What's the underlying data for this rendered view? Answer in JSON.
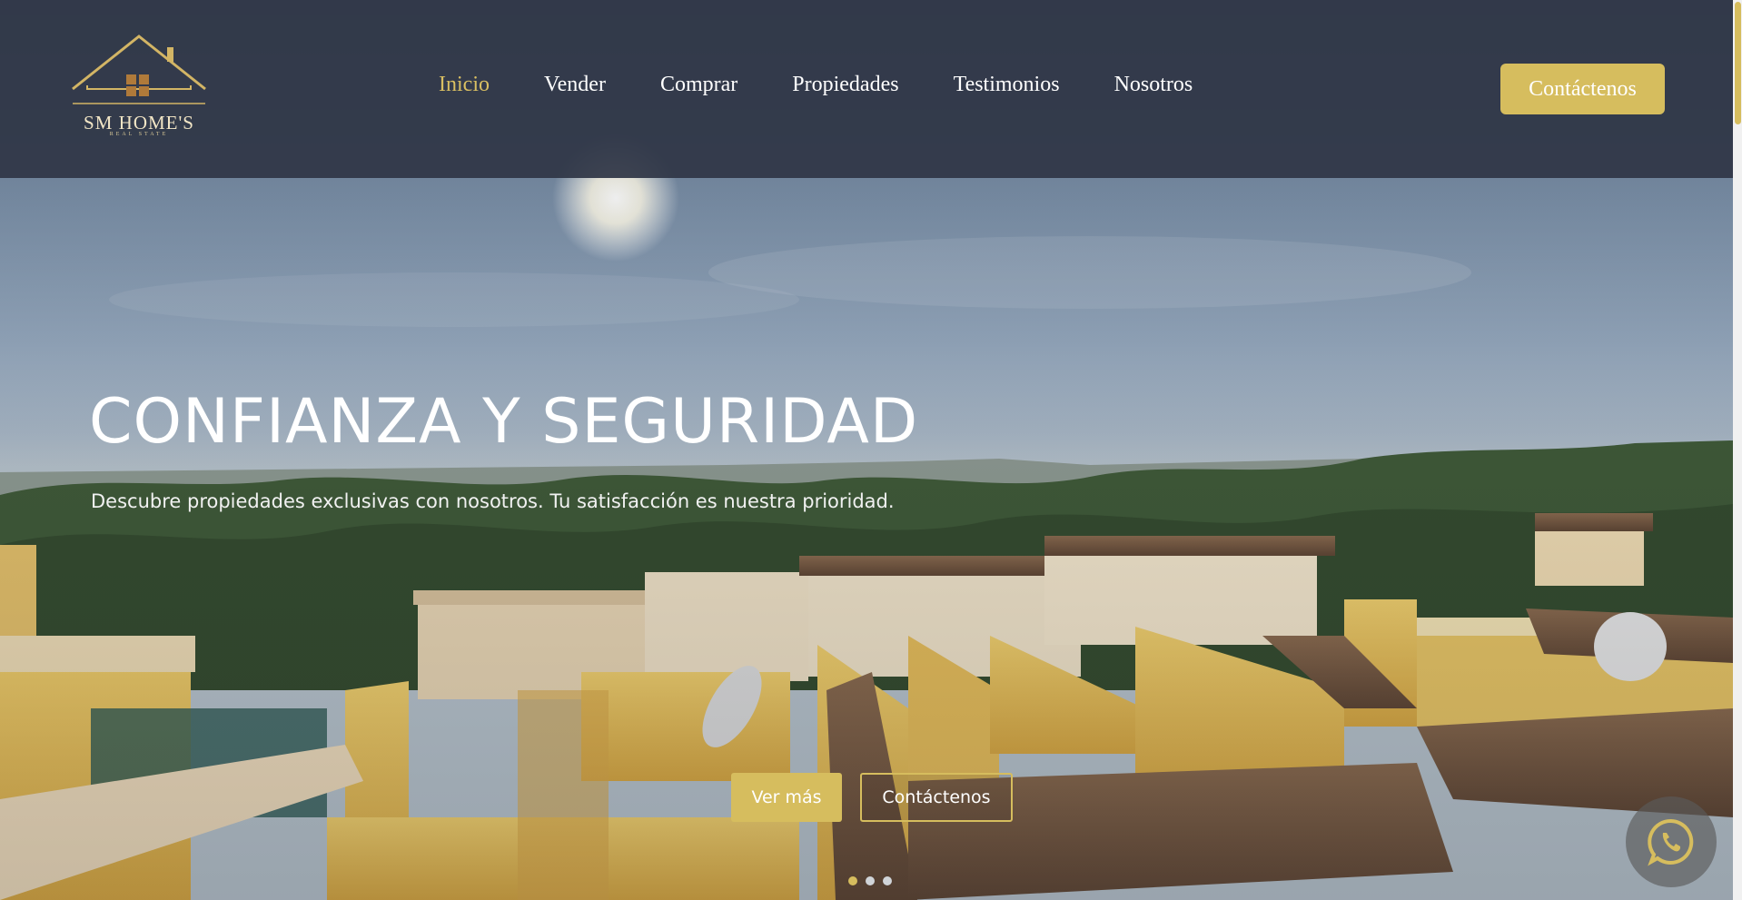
{
  "brand": {
    "name": "SM HOME'S",
    "tagline": "REAL STATE",
    "accent_color": "#d6bd5e",
    "header_color": "#2f3646"
  },
  "nav": {
    "items": [
      {
        "label": "Inicio",
        "active": true
      },
      {
        "label": "Vender",
        "active": false
      },
      {
        "label": "Comprar",
        "active": false
      },
      {
        "label": "Propiedades",
        "active": false
      },
      {
        "label": "Testimonios",
        "active": false
      },
      {
        "label": "Nosotros",
        "active": false
      }
    ],
    "cta_label": "Contáctenos"
  },
  "hero": {
    "title": "CONFIANZA Y SEGURIDAD",
    "subtitle": "Descubre propiedades exclusivas con nosotros. Tu satisfacción es nuestra prioridad.",
    "primary_button": "Ver más",
    "secondary_button": "Contáctenos",
    "slides_total": 3,
    "active_slide": 1
  },
  "floating": {
    "icon": "whatsapp-icon"
  }
}
